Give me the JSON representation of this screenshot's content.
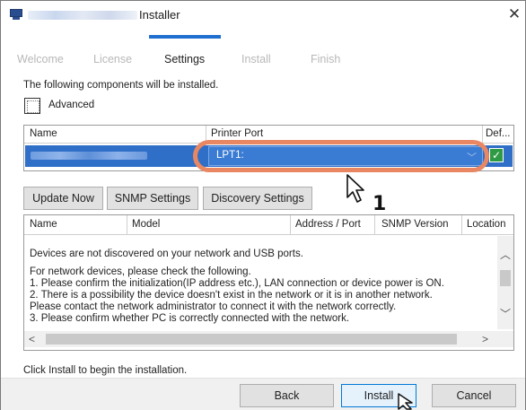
{
  "window": {
    "title": "Installer",
    "close_glyph": "✕"
  },
  "steps": [
    {
      "label": "Welcome",
      "active": false
    },
    {
      "label": "License",
      "active": false
    },
    {
      "label": "Settings",
      "active": true
    },
    {
      "label": "Install",
      "active": false
    },
    {
      "label": "Finish",
      "active": false
    }
  ],
  "intro_text": "The following components will be installed.",
  "advanced": {
    "label": "Advanced",
    "checked": false
  },
  "components": {
    "columns": [
      "Name",
      "Printer Port",
      "Def..."
    ],
    "rows": [
      {
        "printer_port": "LPT1:",
        "default": true
      }
    ]
  },
  "buttons": {
    "update_now": "Update Now",
    "snmp_settings": "SNMP Settings",
    "discovery_settings": "Discovery Settings",
    "back": "Back",
    "install": "Install",
    "cancel": "Cancel"
  },
  "devices": {
    "columns": [
      "Name",
      "Model",
      "Address / Port",
      "SNMP Version",
      "Location"
    ],
    "messages": [
      "Devices are not discovered on your network and USB ports.",
      "For network devices, please check the following.",
      "1. Please confirm the initialization(IP address etc.), LAN connection or device power is ON.",
      "2. There is a possibility the device doesn't exist in the network or it is in another network.",
      "Please contact the network administrator to connect it with the network correctly.",
      "3. Please confirm whether PC is correctly connected with the network."
    ]
  },
  "footer_text": "Click Install to begin the installation.",
  "annotation": {
    "step_number": "1"
  },
  "colors": {
    "accent": "#1f6fd0",
    "selection": "#2f6fc8",
    "highlight_ring": "#e88762",
    "default_check": "#2e9a44"
  },
  "icons": [
    "installer-app-icon",
    "close-icon",
    "chevron-down-icon",
    "checkmark-icon",
    "chevron-up-icon",
    "chevron-left-icon",
    "chevron-right-icon",
    "pointer-cursor-icon"
  ]
}
